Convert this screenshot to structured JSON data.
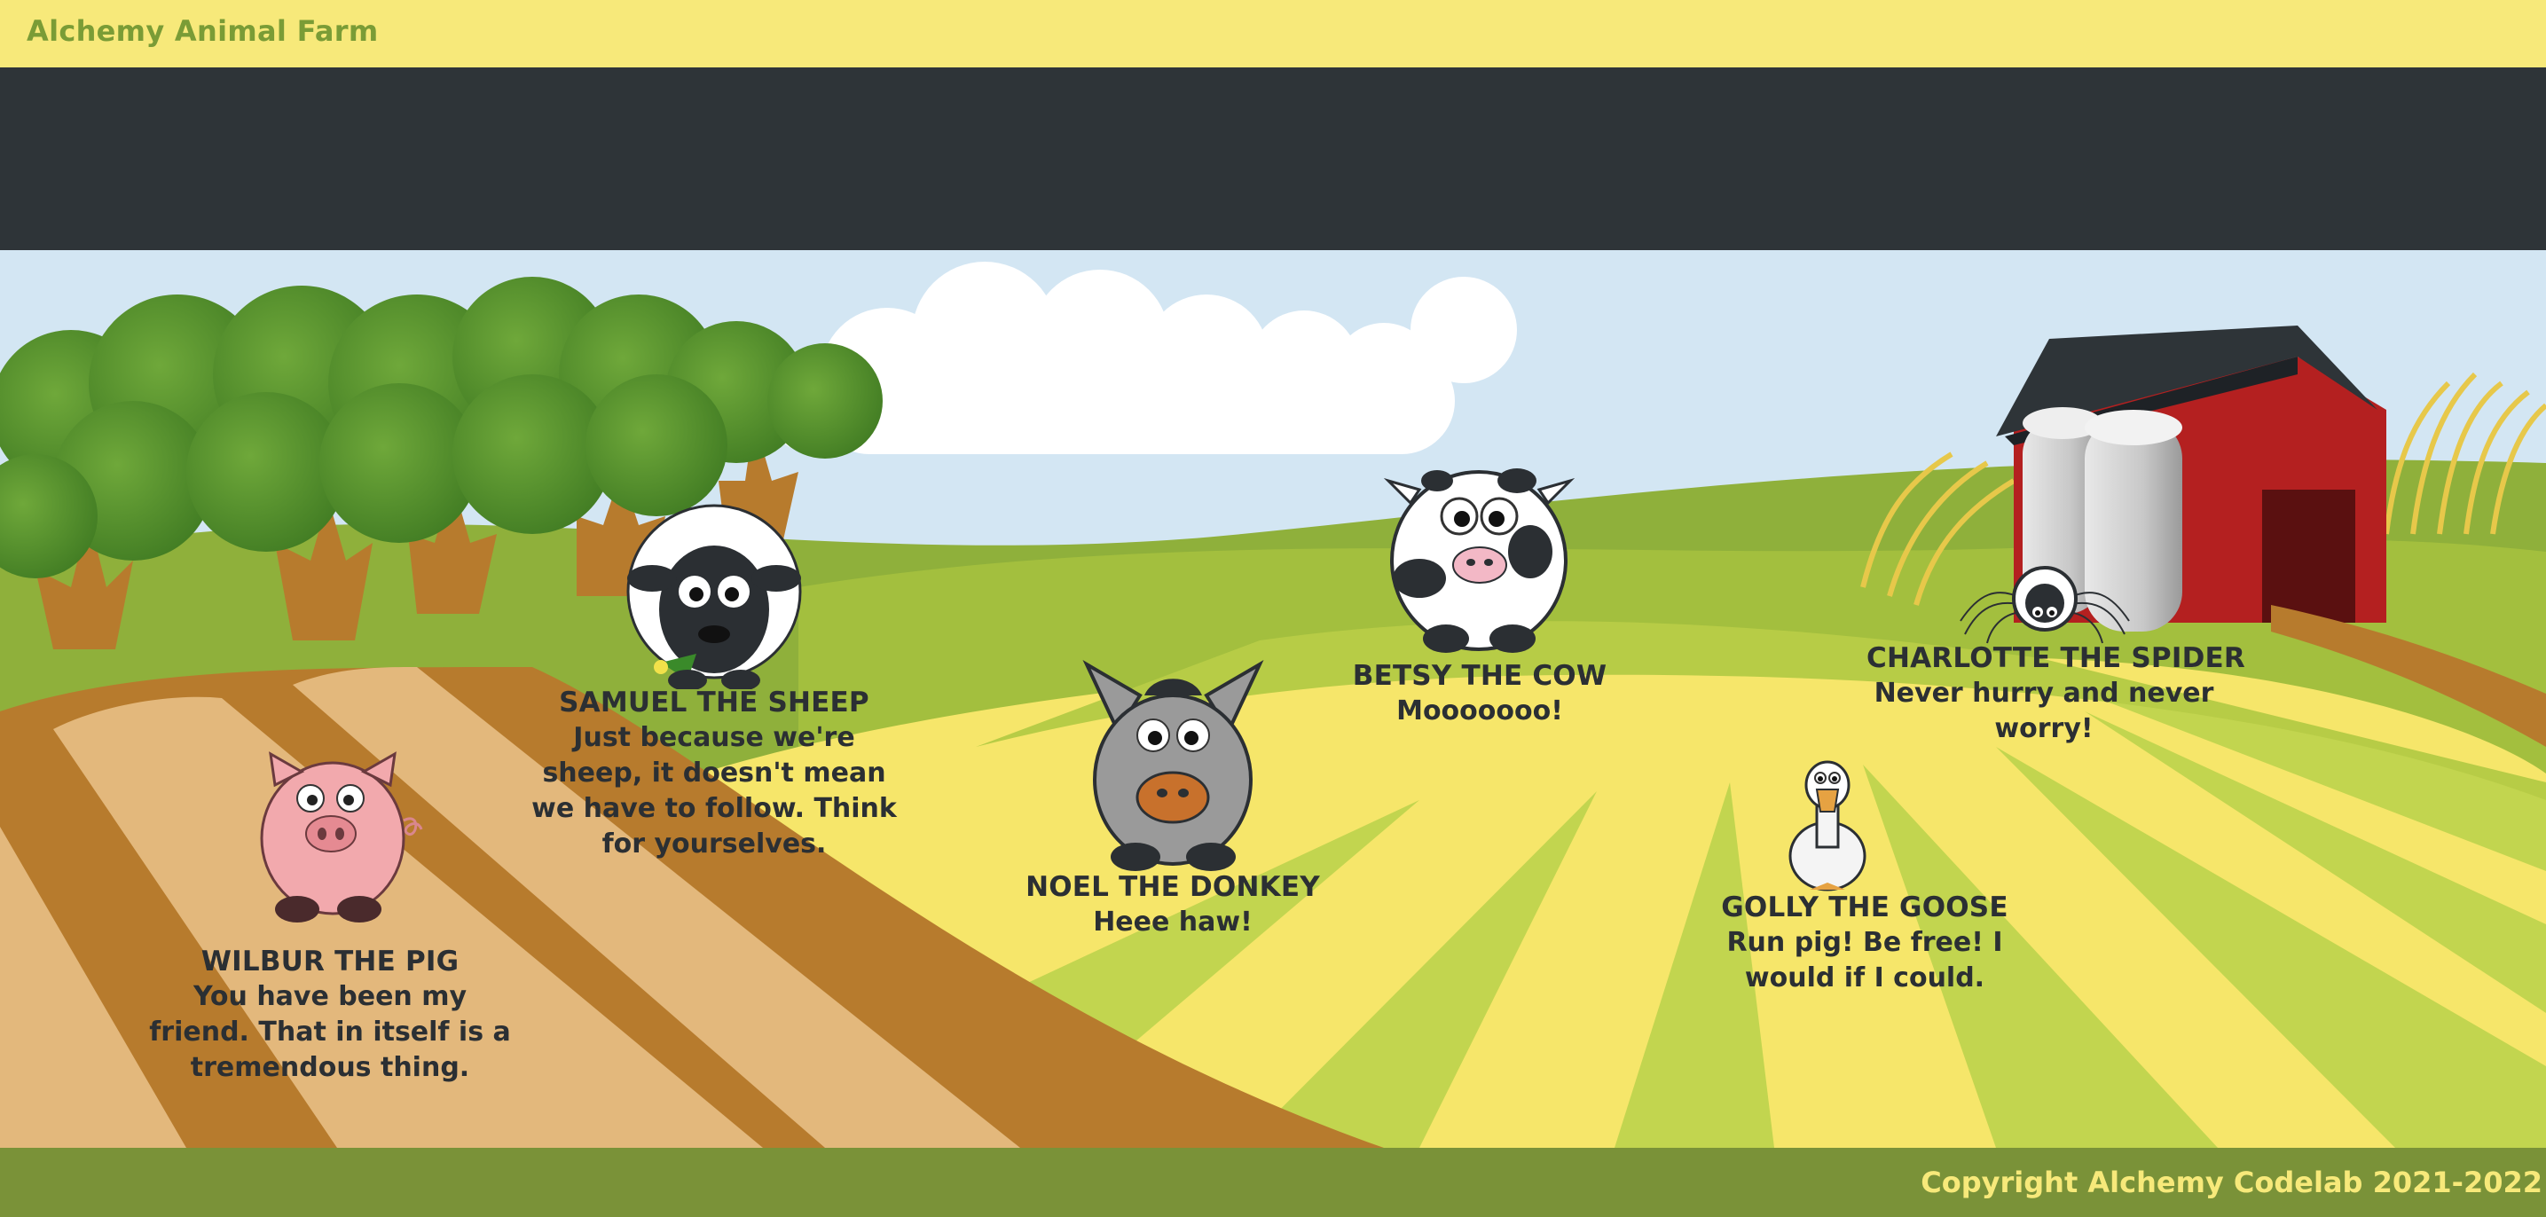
{
  "header": {
    "title": "Alchemy Animal Farm"
  },
  "footer": {
    "copyright": "Copyright Alchemy Codelab 2021-2022"
  },
  "animals": [
    {
      "name": "WILBUR THE PIG",
      "quote": "You have been my friend. That in itself is a tremendous thing."
    },
    {
      "name": "SAMUEL THE SHEEP",
      "quote": "Just because we're sheep, it doesn't mean we have to follow. Think for yourselves."
    },
    {
      "name": "NOEL THE DONKEY",
      "quote": "Heee haw!"
    },
    {
      "name": "BETSY THE COW",
      "quote": "Mooooooo!"
    },
    {
      "name": "CHARLOTTE THE SPIDER",
      "quote": "Never hurry and never worry!"
    },
    {
      "name": "GOLLY THE GOOSE",
      "quote": "Run pig! Be free! I would if I could."
    }
  ],
  "colors": {
    "header_bg": "#f7e97a",
    "title_text": "#7a9c36",
    "dark_band": "#2e3438",
    "footer_bg": "#7a9238",
    "footer_text": "#f7e97a",
    "sky": "#d3e6f3"
  }
}
